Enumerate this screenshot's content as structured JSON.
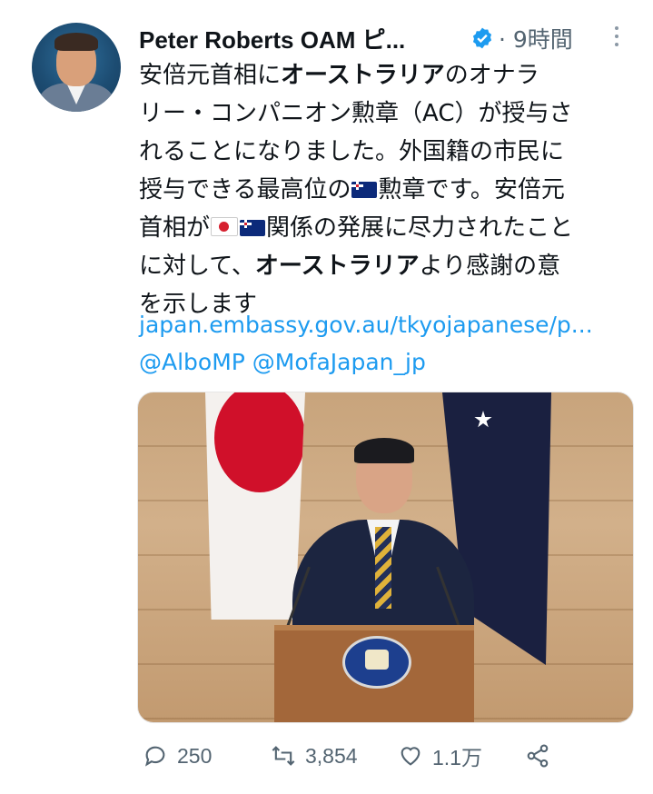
{
  "author": {
    "display_name": "Peter Roberts OAM ピ...",
    "verified_icon": "verified-badge-icon",
    "separator": "·",
    "time_ago": "9時間"
  },
  "tweet": {
    "line1_a": "安倍元首相に",
    "line1_b": "オーストラリア",
    "line1_c": "のオナラ",
    "line2": "リー・コンパニオン勲章（AC）が授与さ",
    "line3": "れることになりました。外国籍の市民に",
    "line4_a": "授与できる最高位の",
    "line4_b": "勲章です。安倍元",
    "line5_a": "首相が",
    "line5_b": "関係の発展に尽力されたこと",
    "line6_a": "に対して、",
    "line6_b": "オーストラリア",
    "line6_c": "より感謝の意",
    "line7": "を示します",
    "link": "japan.embassy.gov.au/tkyojapanese/p...",
    "mentions": "@AlboMP @MofaJapan_jp"
  },
  "actions": {
    "replies": "250",
    "retweets": "3,854",
    "likes": "1.1万"
  },
  "colors": {
    "link": "#1d9bf0",
    "muted": "#536471",
    "verified": "#1d9bf0"
  }
}
